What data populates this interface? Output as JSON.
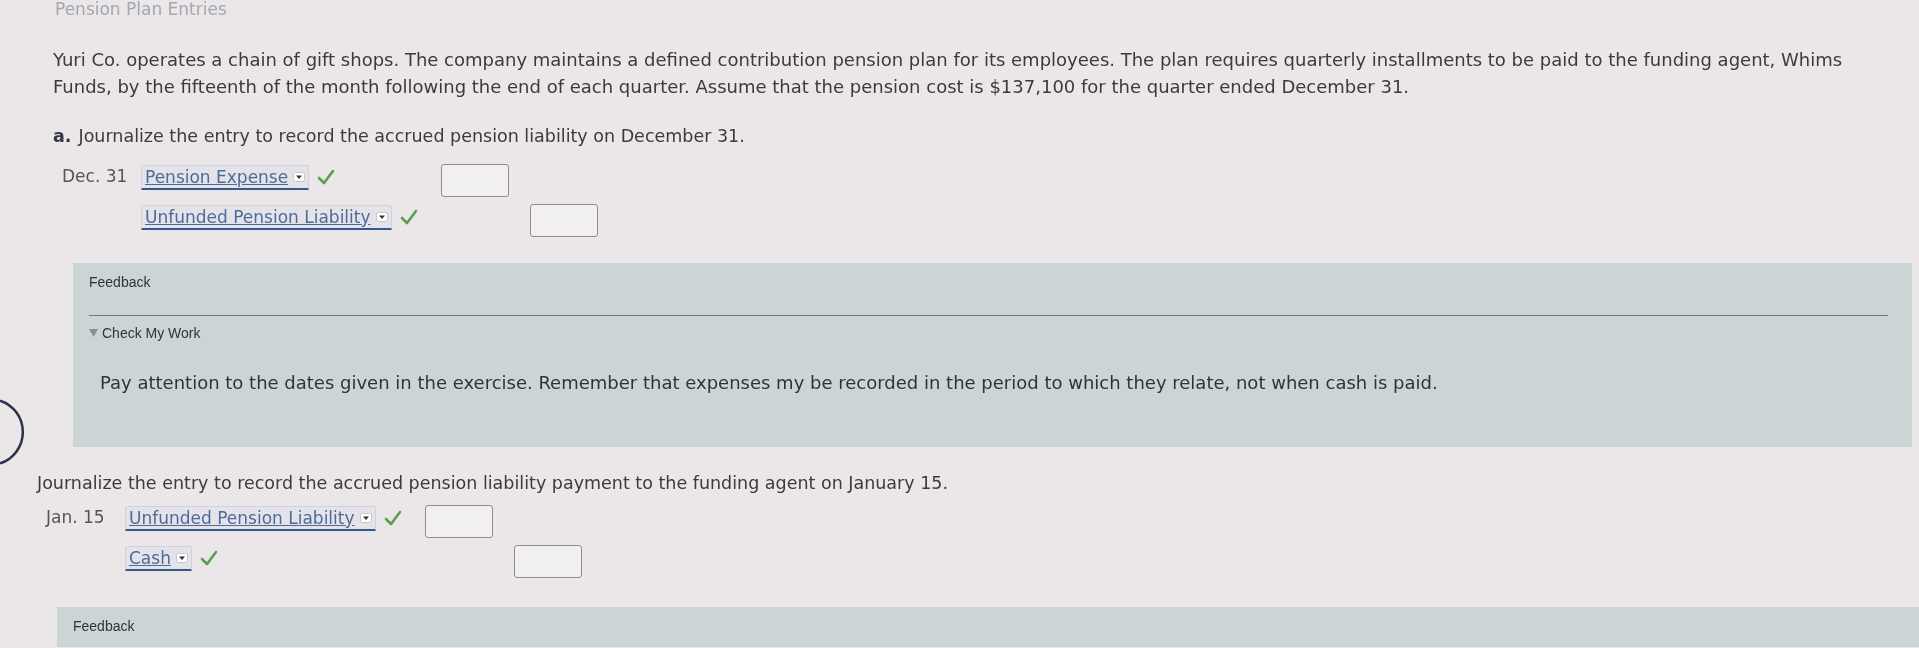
{
  "page": {
    "title": "Pension Plan Entries"
  },
  "problem": {
    "text": "Yuri Co. operates a chain of gift shops. The company maintains a defined contribution pension plan for its employees. The plan requires quarterly installments to be paid to the funding agent, Whims Funds, by the fifteenth of the month following the end of each quarter. Assume that the pension cost is $137,100 for the quarter ended December 31."
  },
  "parts": [
    {
      "label": "a.",
      "instruction": "Journalize the entry to record the accrued pension liability on December 31.",
      "entries": [
        {
          "date": "Dec. 31",
          "account": "Pension Expense",
          "correct": true,
          "kind": "debit"
        },
        {
          "account": "Unfunded Pension Liability",
          "correct": true,
          "kind": "credit"
        }
      ],
      "feedback": {
        "title": "Feedback",
        "toggle": {
          "label": "Check My Work",
          "expanded": true
        },
        "text": "Pay attention to the dates given in the exercise. Remember that expenses my be recorded in the period to which they relate, not when cash is paid."
      }
    },
    {
      "instruction": "Journalize the entry to record the accrued pension liability payment to the funding agent on January 15.",
      "entries": [
        {
          "date": "Jan. 15",
          "account": "Unfunded Pension Liability",
          "correct": true,
          "kind": "debit"
        },
        {
          "account": "Cash",
          "correct": true,
          "kind": "credit"
        }
      ],
      "feedback": {
        "title": "Feedback"
      }
    }
  ]
}
